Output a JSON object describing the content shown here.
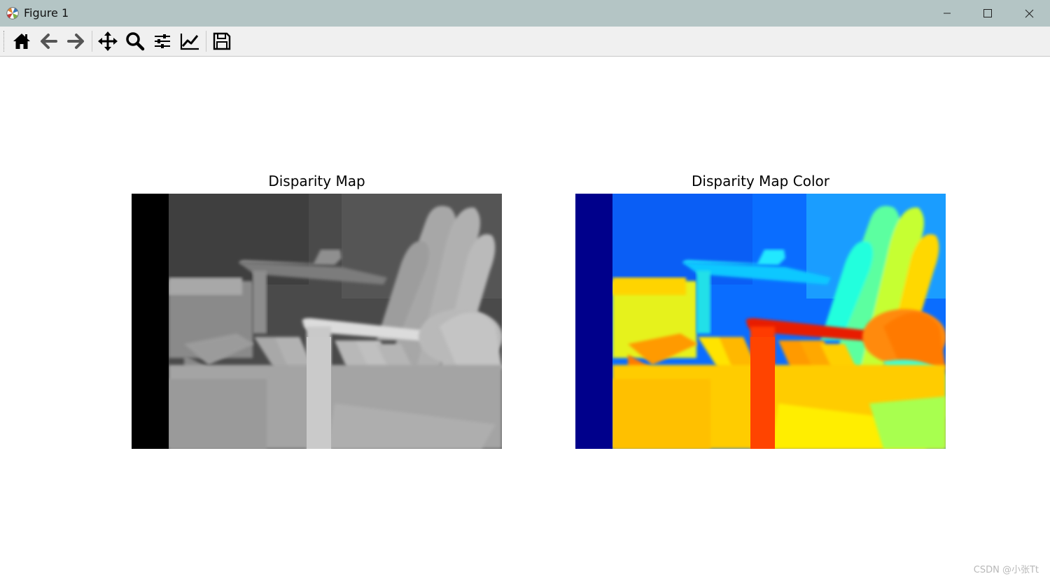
{
  "window": {
    "title": "Figure 1",
    "icon": "matplotlib-logo-icon",
    "controls": [
      "minimize-icon",
      "maximize-icon",
      "close-icon"
    ]
  },
  "toolbar": {
    "tools": [
      {
        "name": "home-icon"
      },
      {
        "name": "back-arrow-icon"
      },
      {
        "name": "forward-arrow-icon"
      },
      {
        "name": "pan-move-icon"
      },
      {
        "name": "zoom-magnifier-icon"
      },
      {
        "name": "configure-subplots-icon"
      },
      {
        "name": "edit-axis-curve-icon"
      },
      {
        "name": "save-floppy-icon"
      }
    ]
  },
  "figure": {
    "left_axes": {
      "title": "Disparity Map",
      "colormap": "gray"
    },
    "right_axes": {
      "title": "Disparity Map Color",
      "colormap": "jet"
    }
  },
  "watermark": "CSDN @小张Tt",
  "colors": {
    "titlebar": "#b4c5c5",
    "toolbar": "#f0f0f0",
    "jet_dark_blue": "#00008b"
  }
}
